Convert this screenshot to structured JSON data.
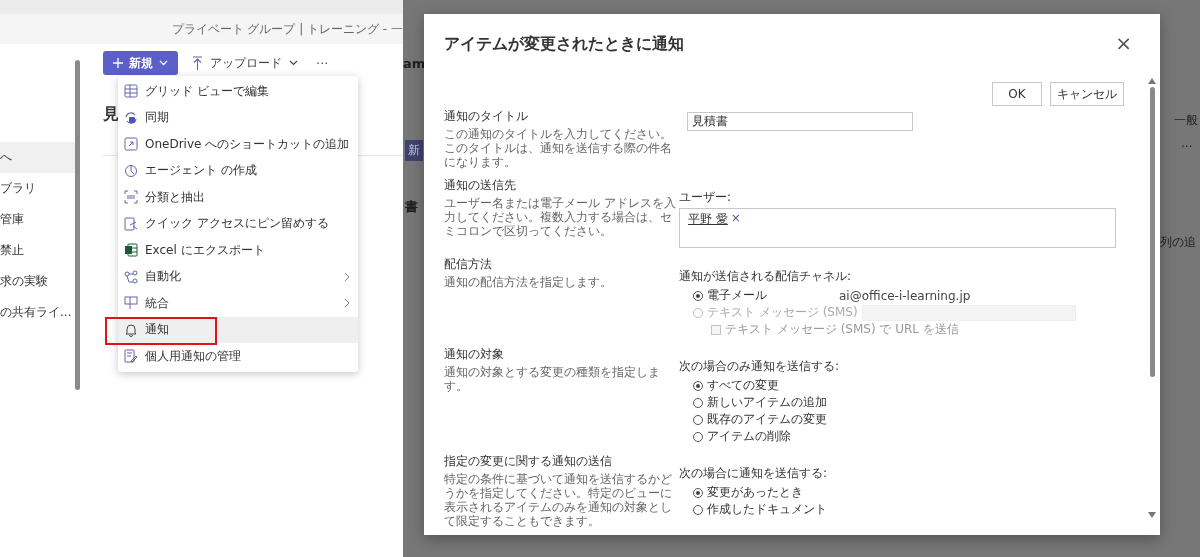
{
  "left": {
    "breadcrumb": "プライベート グループ | トレーニング - 一",
    "sidebar": [
      {
        "label": "へ",
        "selected": true
      },
      {
        "label": "ブラリ",
        "selected": false
      },
      {
        "label": "管庫",
        "selected": false
      },
      {
        "label": "禁止",
        "selected": false
      },
      {
        "label": "求の実験",
        "selected": false
      },
      {
        "label": "の共有ライ...",
        "selected": false
      }
    ],
    "toolbar": {
      "new_button": "新規",
      "upload_button": "アップロード",
      "more": "···"
    },
    "heading": "見",
    "menu": [
      {
        "kind": "grid",
        "label": "グリッド ビューで編集",
        "submenu": false,
        "selected": false
      },
      {
        "kind": "sync",
        "label": "同期",
        "submenu": false,
        "selected": false
      },
      {
        "kind": "shortcut",
        "label": "OneDrive へのショートカットの追加",
        "submenu": false,
        "selected": false
      },
      {
        "kind": "agent",
        "label": "エージェント の作成",
        "submenu": false,
        "selected": false
      },
      {
        "kind": "extract",
        "label": "分類と抽出",
        "submenu": false,
        "selected": false
      },
      {
        "kind": "pin",
        "label": "クイック アクセスにピン留めする",
        "submenu": false,
        "selected": false
      },
      {
        "kind": "excel",
        "label": "Excel にエクスポート",
        "submenu": false,
        "selected": false
      },
      {
        "kind": "automate",
        "label": "自動化",
        "submenu": true,
        "selected": false
      },
      {
        "kind": "integrate",
        "label": "統合",
        "submenu": true,
        "selected": false
      },
      {
        "kind": "bell",
        "label": "通知",
        "submenu": false,
        "selected": true
      },
      {
        "kind": "manage",
        "label": "個人用通知の管理",
        "submenu": false,
        "selected": false
      }
    ]
  },
  "background": [
    "am",
    "一般",
    "新",
    "···",
    "書",
    "列の追"
  ],
  "dialog": {
    "title": "アイテムが変更されたときに通知",
    "close": "×",
    "buttons": [
      "OK",
      "キャンセル"
    ],
    "sections": [
      {
        "kind": "text",
        "title": "通知のタイトル",
        "description": "この通知のタイトルを入力してください。このタイトルは、通知を送信する際の件名になります。",
        "value": "見積書"
      },
      {
        "kind": "people",
        "title": "通知の送信先",
        "description": "ユーザー名または電子メール アドレスを入力してください。複数入力する場合は、セミコロンで区切ってください。",
        "field_label": "ユーザー:",
        "people": [
          {
            "name": "平野 愛",
            "remove": "×"
          }
        ]
      },
      {
        "kind": "choice",
        "title": "配信方法",
        "description": "通知の配信方法を指定します。",
        "field_label": "通知が送信される配信チャネル:",
        "options": [
          {
            "label": "電子メール",
            "selected": true,
            "disabled": false,
            "value": "ai@office-i-learning.jp"
          },
          {
            "label": "テキスト メッセージ (SMS)",
            "selected": false,
            "disabled": true,
            "field": true
          }
        ],
        "checkbox": {
          "label": "テキスト メッセージ (SMS) で URL を送信",
          "checked": false,
          "disabled": true
        }
      },
      {
        "kind": "choice",
        "title": "通知の対象",
        "description": "通知の対象とする変更の種類を指定します。",
        "field_label": "次の場合のみ通知を送信する:",
        "options": [
          {
            "label": "すべての変更",
            "selected": true,
            "disabled": false
          },
          {
            "label": "新しいアイテムの追加",
            "selected": false,
            "disabled": false
          },
          {
            "label": "既存のアイテムの変更",
            "selected": false,
            "disabled": false
          },
          {
            "label": "アイテムの削除",
            "selected": false,
            "disabled": false
          }
        ]
      },
      {
        "kind": "choice",
        "title": "指定の変更に関する通知の送信",
        "description": "特定の条件に基づいて通知を送信するかどうかを指定してください。特定のビューに表示されるアイテムのみを通知の対象として限定することもできます。",
        "field_label": "次の場合に通知を送信する:",
        "options": [
          {
            "label": "変更があったとき",
            "selected": true,
            "disabled": false
          },
          {
            "label": "作成したドキュメント",
            "selected": false,
            "disabled": false
          }
        ]
      }
    ]
  }
}
